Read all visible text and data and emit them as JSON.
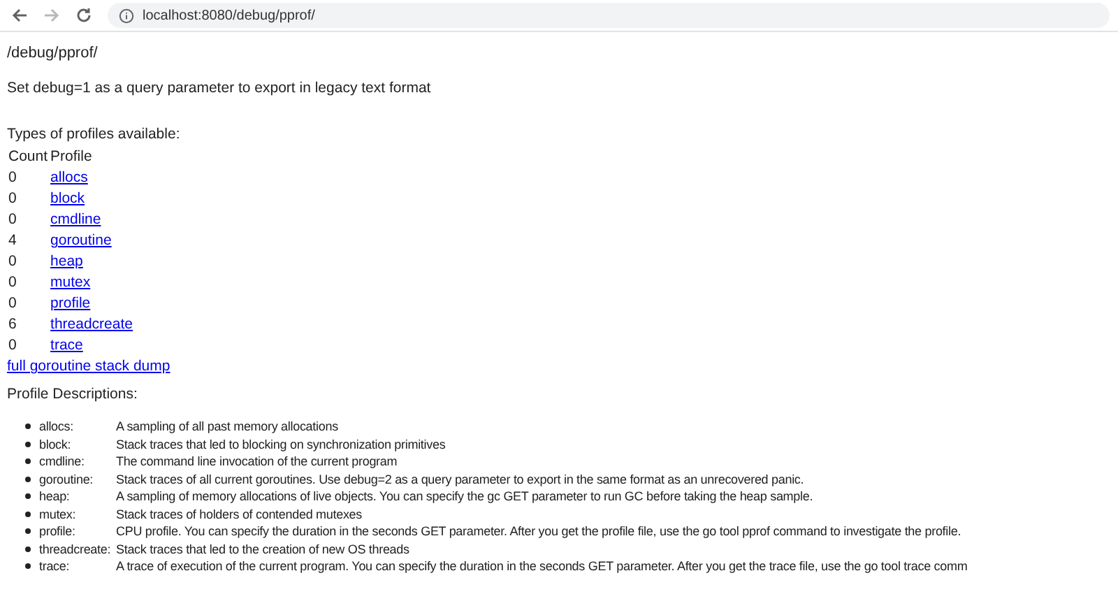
{
  "browser": {
    "url": "localhost:8080/debug/pprof/"
  },
  "page": {
    "heading": "/debug/pprof/",
    "note": "Set debug=1 as a query parameter to export in legacy text format",
    "types_title": "Types of profiles available:",
    "table": {
      "columns": [
        "Count",
        "Profile"
      ],
      "rows": [
        {
          "count": "0",
          "profile": "allocs"
        },
        {
          "count": "0",
          "profile": "block"
        },
        {
          "count": "0",
          "profile": "cmdline"
        },
        {
          "count": "4",
          "profile": "goroutine"
        },
        {
          "count": "0",
          "profile": "heap"
        },
        {
          "count": "0",
          "profile": "mutex"
        },
        {
          "count": "0",
          "profile": "profile"
        },
        {
          "count": "6",
          "profile": "threadcreate"
        },
        {
          "count": "0",
          "profile": "trace"
        }
      ]
    },
    "dump_link": "full goroutine stack dump",
    "descriptions_title": "Profile Descriptions:",
    "descriptions": [
      {
        "term": "allocs:",
        "text": "A sampling of all past memory allocations"
      },
      {
        "term": "block:",
        "text": "Stack traces that led to blocking on synchronization primitives"
      },
      {
        "term": "cmdline:",
        "text": "The command line invocation of the current program"
      },
      {
        "term": "goroutine:",
        "text": "Stack traces of all current goroutines. Use debug=2 as a query parameter to export in the same format as an unrecovered panic."
      },
      {
        "term": "heap:",
        "text": "A sampling of memory allocations of live objects. You can specify the gc GET parameter to run GC before taking the heap sample."
      },
      {
        "term": "mutex:",
        "text": "Stack traces of holders of contended mutexes"
      },
      {
        "term": "profile:",
        "text": "CPU profile. You can specify the duration in the seconds GET parameter. After you get the profile file, use the go tool pprof command to investigate the profile."
      },
      {
        "term": "threadcreate:",
        "text": "Stack traces that led to the creation of new OS threads"
      },
      {
        "term": "trace:",
        "text": "A trace of execution of the current program. You can specify the duration in the seconds GET parameter. After you get the trace file, use the go tool trace comm"
      }
    ]
  }
}
